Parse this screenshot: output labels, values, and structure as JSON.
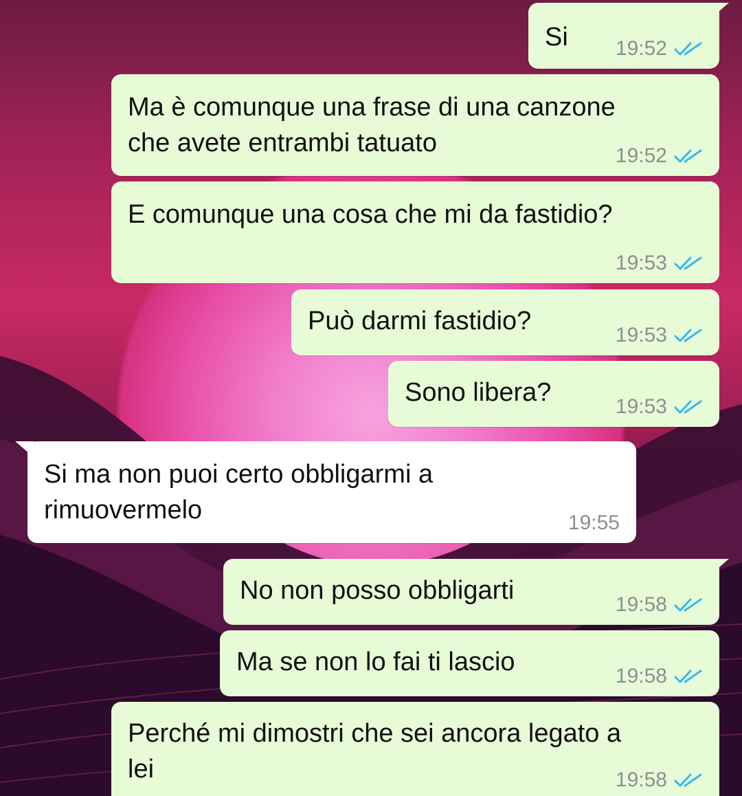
{
  "conversation": {
    "messages": [
      {
        "text": "Si",
        "time": "19:52",
        "direction": "outgoing",
        "status": "read"
      },
      {
        "text": "Ma è comunque una frase di una canzone\nche avete entrambi tatuato",
        "time": "19:52",
        "direction": "outgoing",
        "status": "read"
      },
      {
        "text": "E comunque una cosa che mi da fastidio?",
        "time": "19:53",
        "direction": "outgoing",
        "status": "read"
      },
      {
        "text": "Può darmi fastidio?",
        "time": "19:53",
        "direction": "outgoing",
        "status": "read"
      },
      {
        "text": "Sono libera?",
        "time": "19:53",
        "direction": "outgoing",
        "status": "read"
      },
      {
        "text": "Si ma non puoi certo obbligarmi a\nrimuovermelo",
        "time": "19:55",
        "direction": "incoming",
        "status": ""
      },
      {
        "text": "No non posso obbligarti",
        "time": "19:58",
        "direction": "outgoing",
        "status": "read"
      },
      {
        "text": "Ma se non lo fai ti lascio",
        "time": "19:58",
        "direction": "outgoing",
        "status": "read"
      },
      {
        "text": "Perché mi dimostri che sei ancora legato a\nlei",
        "time": "19:58",
        "direction": "outgoing",
        "status": "read"
      }
    ]
  },
  "theme": {
    "outgoing_bubble": "#e7fcd6",
    "incoming_bubble": "#ffffff",
    "read_tick_color": "#34b7f1",
    "time_color": "#8b8f92",
    "wallpaper": "pink sunset synthwave mountains"
  }
}
